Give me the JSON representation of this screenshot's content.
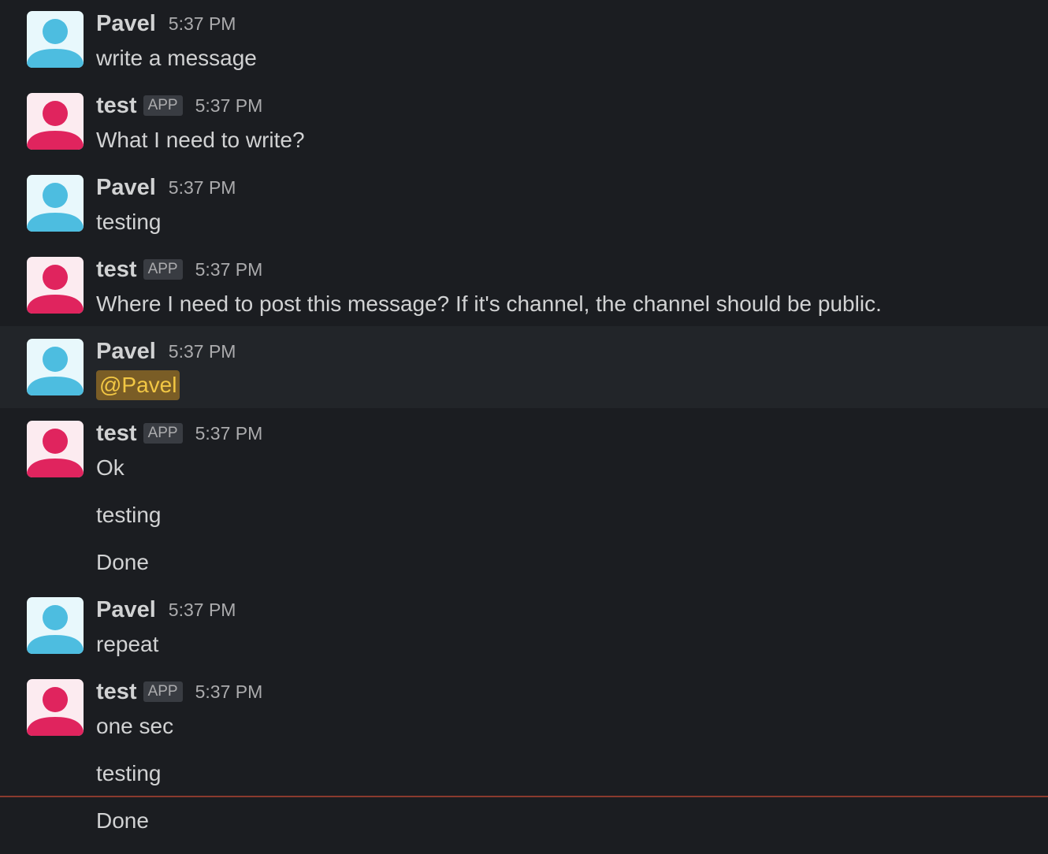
{
  "colors": {
    "background": "#1b1d21",
    "highlight_row": "#222529",
    "user_avatar_bg": "#e8f8fc",
    "user_avatar_fg": "#4dbde0",
    "bot_avatar_bg": "#fcebf0",
    "bot_avatar_fg": "#e0245e",
    "mention_bg": "#7a5d26",
    "mention_text": "#f2c744",
    "new_messages_divider": "#8a3a2e"
  },
  "messages": [
    {
      "sender": "Pavel",
      "time": "5:37 PM",
      "lines": [
        "write a message"
      ]
    },
    {
      "sender": "test",
      "badge": "APP",
      "time": "5:37 PM",
      "lines": [
        "What I need to write?"
      ]
    },
    {
      "sender": "Pavel",
      "time": "5:37 PM",
      "lines": [
        "testing"
      ]
    },
    {
      "sender": "test",
      "badge": "APP",
      "time": "5:37 PM",
      "lines": [
        "Where I need to post this message? If it's channel, the channel should be public."
      ]
    },
    {
      "sender": "Pavel",
      "time": "5:37 PM",
      "mention": "@Pavel"
    },
    {
      "sender": "test",
      "badge": "APP",
      "time": "5:37 PM",
      "lines": [
        "Ok",
        "testing",
        "Done"
      ]
    },
    {
      "sender": "Pavel",
      "time": "5:37 PM",
      "lines": [
        "repeat"
      ]
    },
    {
      "sender": "test",
      "badge": "APP",
      "time": "5:37 PM",
      "lines": [
        "one sec",
        "testing",
        "Done"
      ]
    }
  ]
}
